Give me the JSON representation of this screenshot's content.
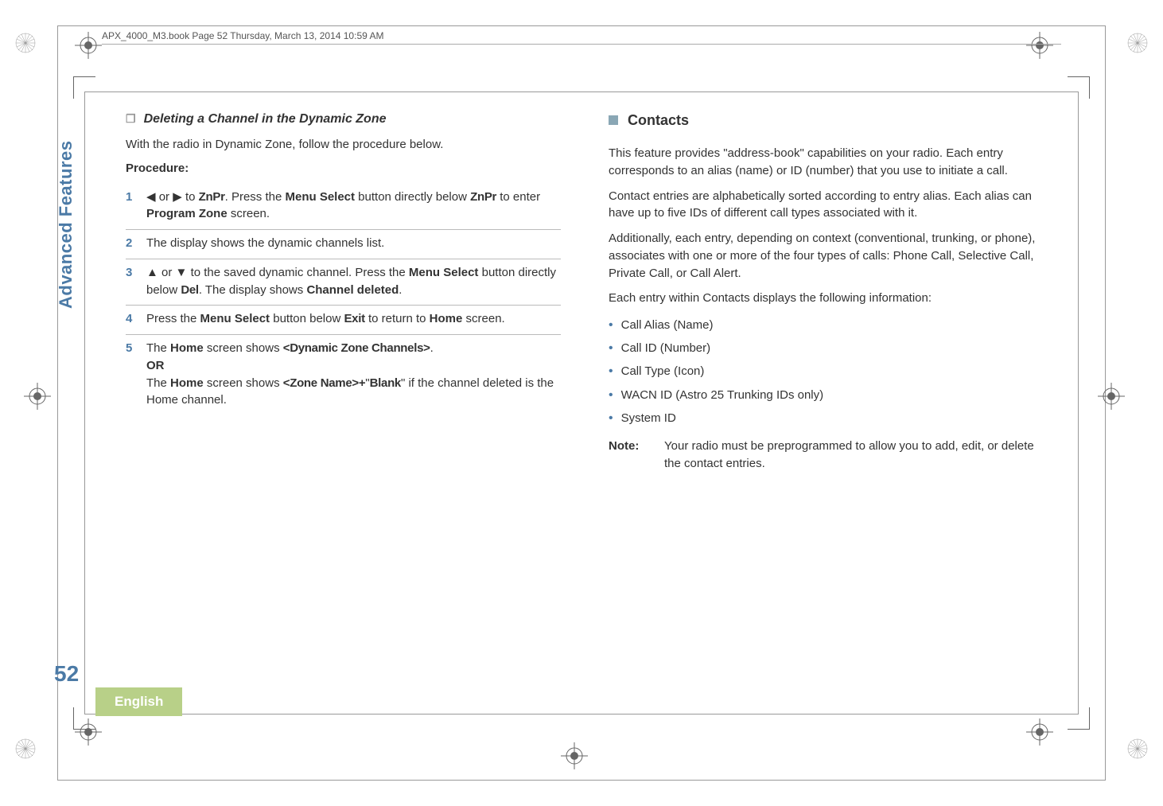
{
  "header": "APX_4000_M3.book  Page 52  Thursday, March 13, 2014  10:59 AM",
  "sidebar": {
    "tab": "Advanced Features",
    "page_num": "52",
    "language": "English"
  },
  "left": {
    "subsection": "Deleting a Channel in the Dynamic Zone",
    "intro": "With the radio in Dynamic Zone, follow the procedure below.",
    "procedure_label": "Procedure:",
    "steps": [
      {
        "num": "1",
        "a": "or",
        "b": " to ",
        "zn": "ZnPr",
        "c": ". Press the ",
        "ms": "Menu Select",
        "d": " button directly below ",
        "zn2": "ZnPr",
        "e": " to enter ",
        "pz": "Program Zone",
        "f": " screen."
      },
      {
        "num": "2",
        "text": "The display shows the dynamic channels list."
      },
      {
        "num": "3",
        "a": "or",
        "b": " to the saved dynamic channel. Press the ",
        "ms": "Menu Select",
        "c": " button directly below ",
        "del": "Del",
        "d": ". The display shows ",
        "cd": "Channel deleted",
        "e": "."
      },
      {
        "num": "4",
        "a": "Press the ",
        "ms": "Menu Select",
        "b": " button below ",
        "exit": "Exit",
        "c": " to return to ",
        "home": "Home",
        "d": " screen."
      },
      {
        "num": "5",
        "a": "The ",
        "home": "Home",
        "b": " screen shows ",
        "dzc": "<Dynamic Zone Channels>",
        "c": ".",
        "or": "OR",
        "d": "The ",
        "home2": "Home",
        "e": " screen shows ",
        "zn": "<Zone Name>+",
        "blank": "Blank",
        "f": "\" if the channel deleted is the Home channel.",
        "q": "\""
      }
    ]
  },
  "right": {
    "section": "Contacts",
    "p1": "This feature provides \"address-book\" capabilities on your radio. Each entry corresponds to an alias (name) or ID (number) that you use to initiate a call.",
    "p2": "Contact entries are alphabetically sorted according to entry alias. Each alias can have up to five IDs of different call types associated with it.",
    "p3": "Additionally, each entry, depending on context (conventional, trunking, or phone), associates with one or more of the four types of calls: Phone Call, Selective Call, Private Call, or Call Alert.",
    "p4": "Each entry within Contacts displays the following information:",
    "bullets": [
      "Call Alias (Name)",
      "Call ID (Number)",
      "Call Type (Icon)",
      "WACN ID (Astro 25 Trunking IDs only)",
      "System ID"
    ],
    "note_label": "Note:",
    "note_text": "Your radio must be preprogrammed to allow you to add, edit, or delete the contact entries."
  }
}
